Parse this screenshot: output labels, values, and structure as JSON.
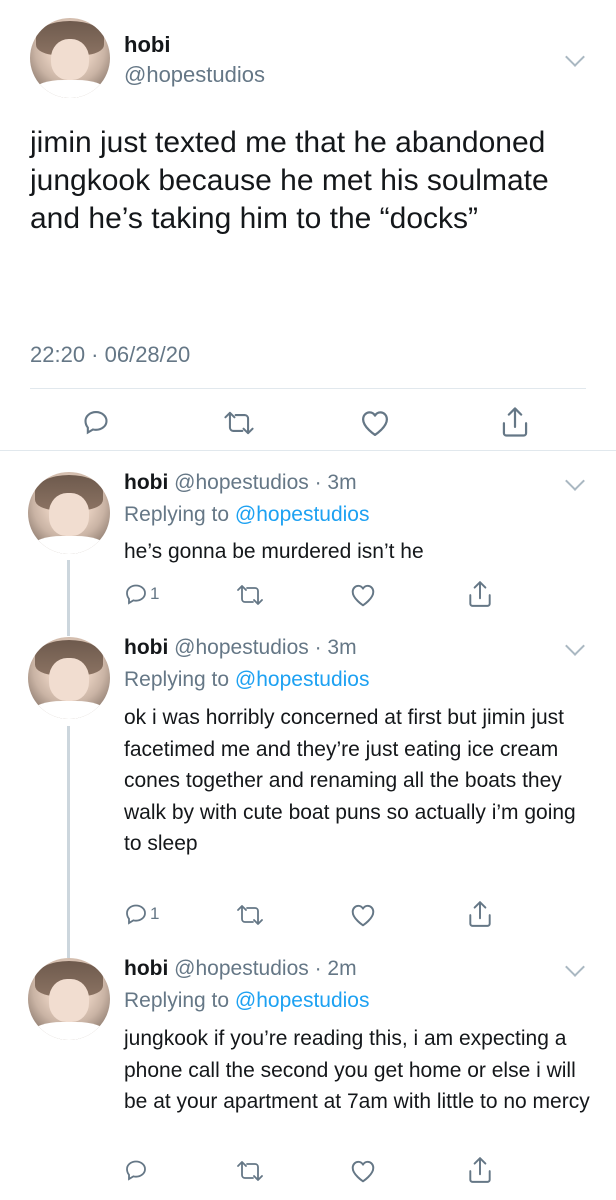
{
  "main_tweet": {
    "name": "hobi",
    "handle": "@hopestudios",
    "text": "jimin just texted me that he abandoned jungkook because he met his soulmate and he’s taking him to the “docks”",
    "timestamp": "22:20 · 06/28/20",
    "actions": [
      "reply-icon",
      "retweet-icon",
      "like-icon",
      "share-icon"
    ]
  },
  "replies": [
    {
      "name": "hobi",
      "handle": "@hopestudios",
      "time": "· 3m",
      "replying_prefix": "Replying to",
      "replying_to": "@hopestudios",
      "text": "he’s gonna be murdered isn’t he",
      "reply_count": "1"
    },
    {
      "name": "hobi",
      "handle": "@hopestudios",
      "time": "· 3m",
      "replying_prefix": "Replying to",
      "replying_to": "@hopestudios",
      "text": "ok i was horribly concerned at first but jimin just facetimed me and they’re just eating ice cream cones together and renaming all the boats they walk by with cute boat puns so actually i’m going to sleep",
      "reply_count": "1"
    },
    {
      "name": "hobi",
      "handle": "@hopestudios",
      "time": "· 2m",
      "replying_prefix": "Replying to",
      "replying_to": "@hopestudios",
      "text": "jungkook if you’re reading this, i am expecting a phone call the second you get home or else i will be at your apartment at 7am with little to no mercy",
      "reply_count": ""
    }
  ],
  "colors": {
    "text": "#14171a",
    "muted": "#657786",
    "link": "#1da1f2",
    "border": "#e1e8ed",
    "thread_line": "#ccd6dd"
  }
}
